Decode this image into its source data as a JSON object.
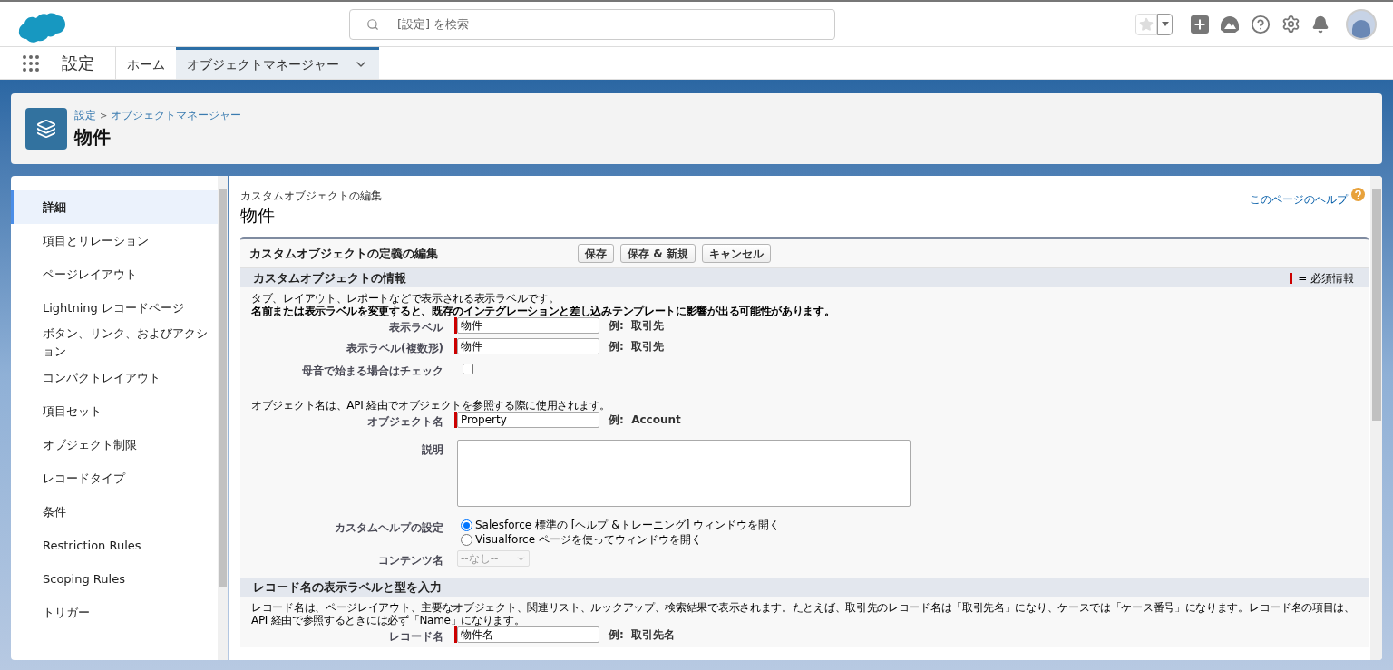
{
  "header": {
    "search_placeholder": "[設定] を検索",
    "favorite": false
  },
  "nav": {
    "app_name": "設定",
    "tabs": [
      {
        "label": "ホーム",
        "selected": false,
        "dropdown": false
      },
      {
        "label": "オブジェクトマネージャー",
        "selected": true,
        "dropdown": true
      }
    ]
  },
  "page_header": {
    "breadcrumb": [
      {
        "label": "設定"
      },
      {
        "label": "オブジェクトマネージャー"
      }
    ],
    "separator": ">",
    "title": "物件"
  },
  "sidebar": {
    "items": [
      {
        "label": "詳細",
        "selected": true
      },
      {
        "label": "項目とリレーション",
        "selected": false
      },
      {
        "label": "ページレイアウト",
        "selected": false
      },
      {
        "label": "Lightning レコードページ",
        "selected": false
      },
      {
        "label": "ボタン、リンク、およびアクション",
        "selected": false
      },
      {
        "label": "コンパクトレイアウト",
        "selected": false
      },
      {
        "label": "項目セット",
        "selected": false
      },
      {
        "label": "オブジェクト制限",
        "selected": false
      },
      {
        "label": "レコードタイプ",
        "selected": false
      },
      {
        "label": "条件",
        "selected": false
      },
      {
        "label": "Restriction Rules",
        "selected": false
      },
      {
        "label": "Scoping Rules",
        "selected": false
      },
      {
        "label": "トリガー",
        "selected": false
      }
    ]
  },
  "content": {
    "subtitle": "カスタムオブジェクトの編集",
    "title": "物件",
    "help_link": "このページのヘルプ",
    "form_title": "カスタムオブジェクトの定義の編集",
    "buttons": [
      "保存",
      "保存 & 新規",
      "キャンセル"
    ],
    "sections": [
      {
        "title": "カスタムオブジェクトの情報",
        "legend": "= 必須情報",
        "rows": [
          {
            "kind": "note",
            "text": "タブ、レイアウト、レポートなどで表示される表示ラベルです。",
            "bold": false
          },
          {
            "kind": "note",
            "text": "名前または表示ラベルを変更すると、既存のインテグレーションと差し込みテンプレートに影響が出る可能性があります。",
            "bold": true
          },
          {
            "kind": "text",
            "label": "表示ラベル",
            "value": "物件",
            "required": true,
            "example": "例:  取引先"
          },
          {
            "kind": "text",
            "label": "表示ラベル(複数形)",
            "value": "物件",
            "required": true,
            "example": "例:  取引先"
          },
          {
            "kind": "checkbox",
            "label": "母音で始まる場合はチェック",
            "checked": false
          },
          {
            "kind": "note",
            "text": "オブジェクト名は、API 経由でオブジェクトを参照する際に使用されます。",
            "bold": false
          },
          {
            "kind": "text",
            "label": "オブジェクト名",
            "value": "Property",
            "required": true,
            "example": "例:  Account"
          },
          {
            "kind": "textarea",
            "label": "説明",
            "value": ""
          },
          {
            "kind": "radio",
            "label": "カスタムヘルプの設定",
            "options": [
              {
                "label": "Salesforce 標準の [ヘルプ &トレーニング] ウィンドウを開く",
                "selected": true
              },
              {
                "label": "Visualforce ページを使ってウィンドウを開く",
                "selected": false
              }
            ]
          },
          {
            "kind": "select",
            "label": "コンテンツ名",
            "value": "--なし--",
            "disabled": true
          }
        ]
      },
      {
        "title": "レコード名の表示ラベルと型を入力",
        "rows": [
          {
            "kind": "note",
            "text": "レコード名は、ページレイアウト、主要なオブジェクト、関連リスト、ルックアップ、検索結果で表示されます。たとえば、取引先のレコード名は「取引先名」になり、ケースでは「ケース番号」になります。レコード名の項目は、API 経由で参照するときには必ず「Name」になります。",
            "bold": false
          },
          {
            "kind": "text",
            "label": "レコード名",
            "value": "物件名",
            "required": true,
            "example": "例:  取引先名"
          }
        ]
      }
    ]
  }
}
